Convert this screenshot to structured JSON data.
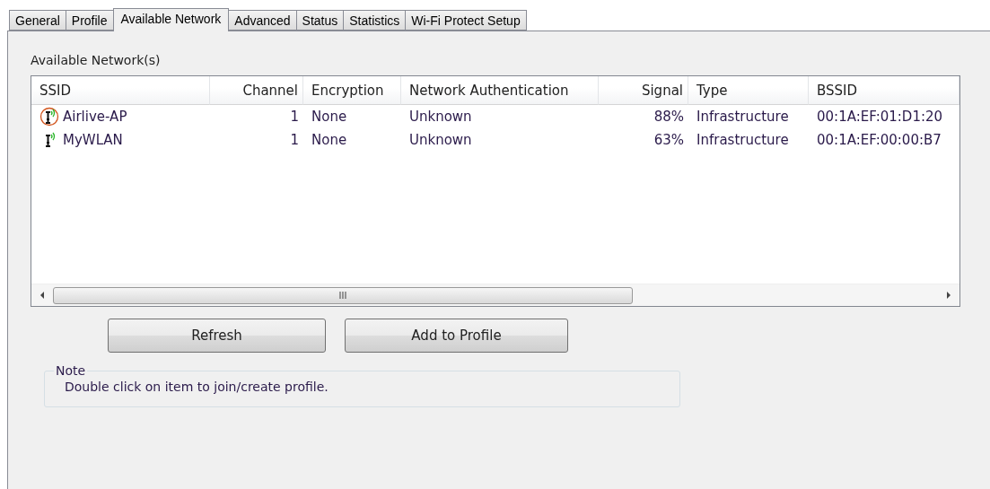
{
  "tabs": [
    {
      "label": "General",
      "selected": false
    },
    {
      "label": "Profile",
      "selected": false
    },
    {
      "label": "Available Network",
      "selected": true
    },
    {
      "label": "Advanced",
      "selected": false
    },
    {
      "label": "Status",
      "selected": false
    },
    {
      "label": "Statistics",
      "selected": false
    },
    {
      "label": "Wi-Fi Protect Setup",
      "selected": false
    }
  ],
  "group_title": "Available Network(s)",
  "table": {
    "columns": [
      "SSID",
      "Channel",
      "Encryption",
      "Network Authentication",
      "Signal",
      "Type",
      "BSSID"
    ],
    "rows": [
      {
        "connected": true,
        "cells": [
          "Airlive-AP",
          "1",
          "None",
          "Unknown",
          "88%",
          "Infrastructure",
          "00:1A:EF:01:D1:20"
        ]
      },
      {
        "connected": false,
        "cells": [
          "MyWLAN",
          "1",
          "None",
          "Unknown",
          "63%",
          "Infrastructure",
          "00:1A:EF:00:00:B7"
        ]
      }
    ],
    "scrollbar_grip": "III"
  },
  "buttons": [
    "Refresh",
    "Add to Profile"
  ],
  "note": {
    "title": "Note",
    "text": "Double click on item to join/create profile."
  }
}
